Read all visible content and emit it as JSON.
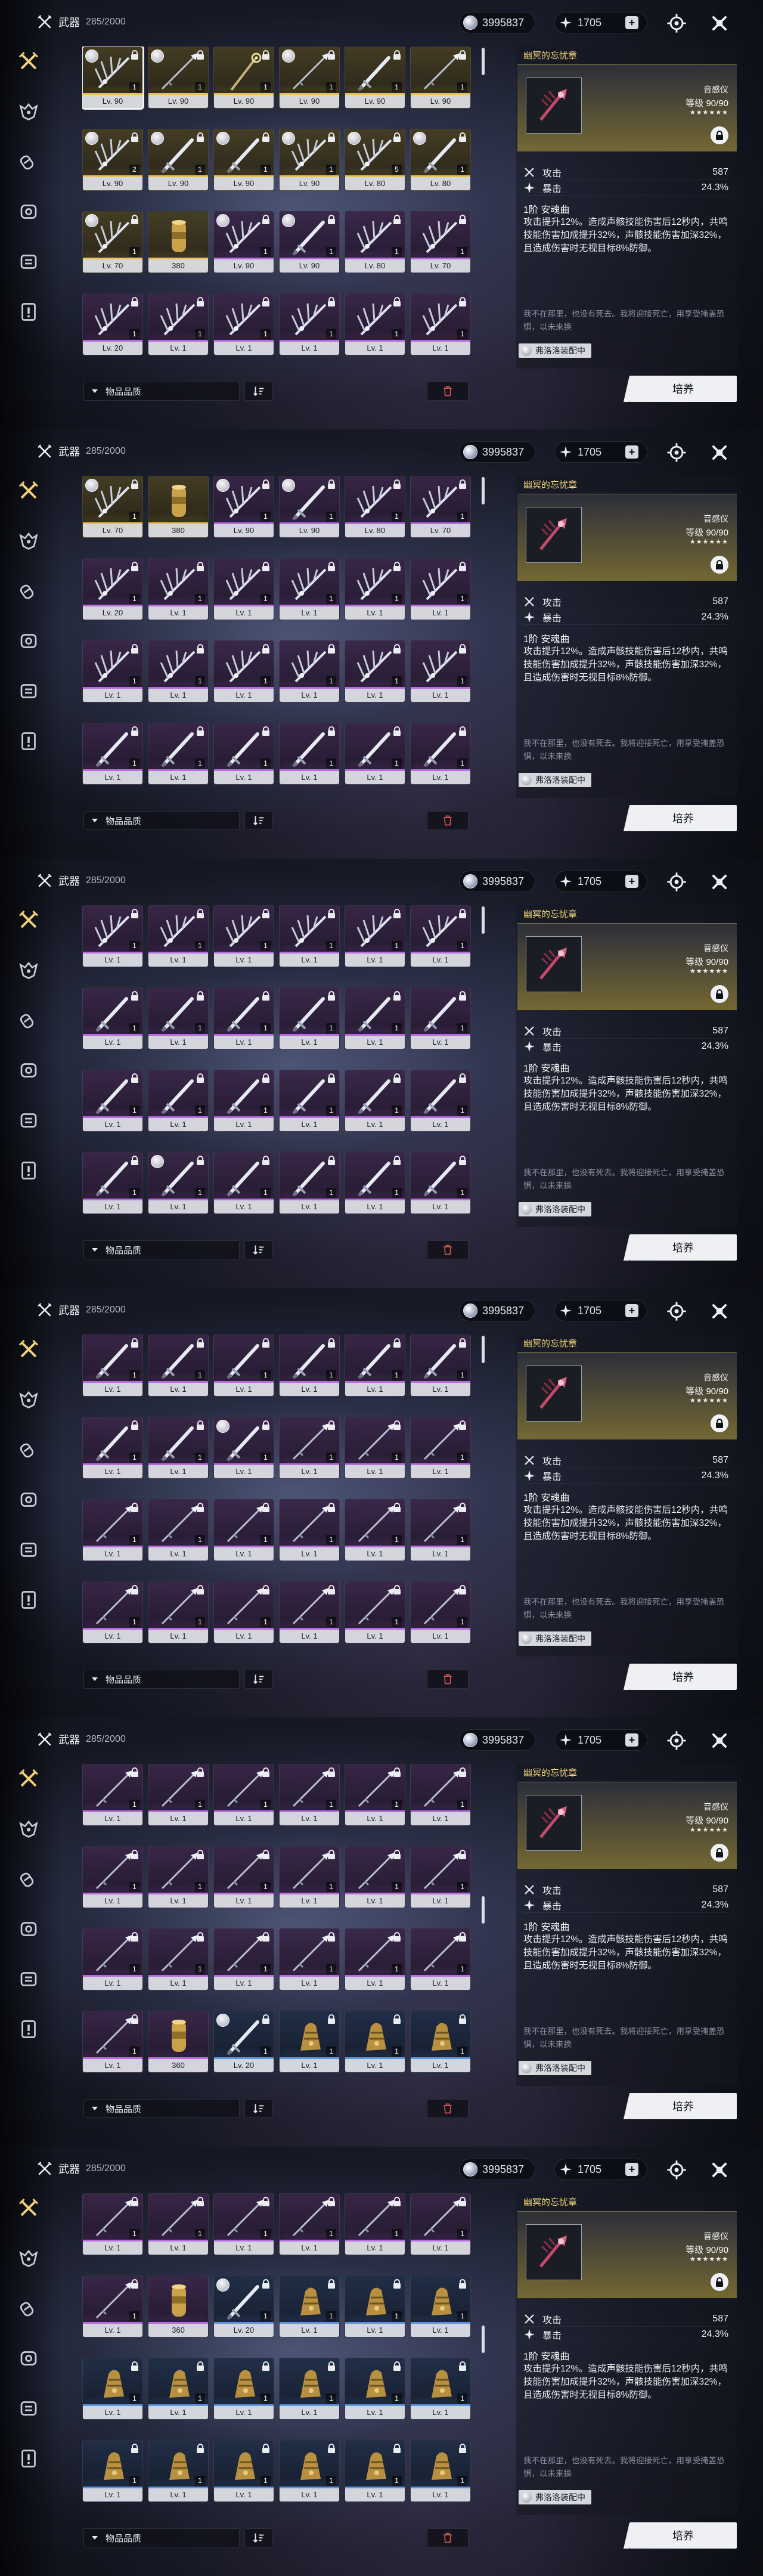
{
  "header": {
    "title": "武器",
    "count": "285/2000"
  },
  "currencies": [
    {
      "icon": "shell-credit-icon",
      "value": "3995837"
    },
    {
      "icon": "astrite-icon",
      "value": "1705",
      "plus": "+"
    }
  ],
  "sidebar": [
    "weapon-icon",
    "echo-icon",
    "supply-icon",
    "resources-icon",
    "key-items-icon",
    "special-icon"
  ],
  "detail": {
    "title": "幽冥的忘忧章",
    "type": "音感仪",
    "level_label": "等级",
    "level": "90/90",
    "stars": "★★★★★★",
    "stats": [
      {
        "icon": "atk-icon",
        "label": "攻击",
        "value": "587"
      },
      {
        "icon": "crit-icon",
        "label": "暴击",
        "value": "24.3%"
      }
    ],
    "skill_name": "1阶 安魂曲",
    "skill_desc": "攻击提升12%。造成声骸技能伤害后12秒内，共鸣技能伤害加成提升32%，声骸技能伤害加深32%，且造成伤害时无视目标8%防御。",
    "flavor": "我不在那里，也没有死去。我将迎接死亡，用享受掩盖恐惧，以未来换",
    "equipped_by": "弗洛洛装配中",
    "cultivate": "培养"
  },
  "bottom": {
    "sort_label": "物品品质"
  },
  "colors": {
    "gold": "#e9c15a",
    "purple": "#b66bde",
    "blue": "#5b95dd",
    "accent_title": "#f1d277"
  },
  "panels": [
    {
      "scroll": "top",
      "items": [
        {
          "lv": "Lv. 90",
          "r": 5,
          "rank": "1",
          "sel": true,
          "equip": true,
          "w": "fan"
        },
        {
          "lv": "Lv. 90",
          "r": 5,
          "rank": "1",
          "equip": true,
          "w": "spear"
        },
        {
          "lv": "Lv. 90",
          "r": 5,
          "rank": "1",
          "w": "staff"
        },
        {
          "lv": "Lv. 90",
          "r": 5,
          "rank": "1",
          "equip": true,
          "w": "spear"
        },
        {
          "lv": "Lv. 90",
          "r": 5,
          "rank": "1",
          "w": "sword"
        },
        {
          "lv": "Lv. 90",
          "r": 5,
          "rank": "1",
          "w": "spear"
        },
        {
          "lv": "Lv. 90",
          "r": 5,
          "rank": "2",
          "equip": true,
          "w": "fan"
        },
        {
          "lv": "Lv. 90",
          "r": 5,
          "rank": "1",
          "equip": true,
          "w": "sword"
        },
        {
          "lv": "Lv. 90",
          "r": 5,
          "rank": "1",
          "equip": true,
          "w": "sword"
        },
        {
          "lv": "Lv. 90",
          "r": 5,
          "rank": "1",
          "equip": true,
          "w": "fan"
        },
        {
          "lv": "Lv. 80",
          "r": 5,
          "rank": "5",
          "equip": true,
          "w": "fan"
        },
        {
          "lv": "Lv. 80",
          "r": 5,
          "rank": "1",
          "equip": true,
          "w": "sword"
        },
        {
          "lv": "Lv. 70",
          "r": 5,
          "rank": "1",
          "equip": true,
          "w": "fan"
        },
        {
          "lv": "380",
          "r": 5,
          "w": "cylinder"
        },
        {
          "lv": "Lv. 90",
          "r": 4,
          "rank": "1",
          "equip": true,
          "w": "fan"
        },
        {
          "lv": "Lv. 90",
          "r": 4,
          "rank": "1",
          "equip": true,
          "w": "sword"
        },
        {
          "lv": "Lv. 80",
          "r": 4,
          "rank": "1",
          "w": "fan"
        },
        {
          "lv": "Lv. 70",
          "r": 4,
          "rank": "1",
          "w": "fan"
        },
        {
          "lv": "Lv. 20",
          "r": 4,
          "rank": "1",
          "w": "fan"
        },
        {
          "lv": "Lv. 1",
          "r": 4,
          "rank": "1",
          "w": "fan"
        },
        {
          "lv": "Lv. 1",
          "r": 4,
          "rank": "1",
          "w": "fan"
        },
        {
          "lv": "Lv. 1",
          "r": 4,
          "rank": "1",
          "w": "fan"
        },
        {
          "lv": "Lv. 1",
          "r": 4,
          "rank": "1",
          "w": "fan"
        },
        {
          "lv": "Lv. 1",
          "r": 4,
          "rank": "1",
          "w": "fan"
        }
      ]
    },
    {
      "scroll": "top",
      "items": [
        {
          "lv": "Lv. 70",
          "r": 5,
          "rank": "1",
          "equip": true,
          "w": "fan"
        },
        {
          "lv": "380",
          "r": 5,
          "w": "cylinder"
        },
        {
          "lv": "Lv. 90",
          "r": 4,
          "rank": "1",
          "equip": true,
          "w": "fan"
        },
        {
          "lv": "Lv. 90",
          "r": 4,
          "rank": "1",
          "equip": true,
          "w": "sword"
        },
        {
          "lv": "Lv. 80",
          "r": 4,
          "rank": "1",
          "w": "fan"
        },
        {
          "lv": "Lv. 70",
          "r": 4,
          "rank": "1",
          "w": "fan"
        },
        {
          "lv": "Lv. 20",
          "r": 4,
          "rank": "1",
          "w": "fan"
        },
        {
          "lv": "Lv. 1",
          "r": 4,
          "rank": "1",
          "w": "fan"
        },
        {
          "lv": "Lv. 1",
          "r": 4,
          "rank": "1",
          "w": "fan"
        },
        {
          "lv": "Lv. 1",
          "r": 4,
          "rank": "1",
          "w": "fan"
        },
        {
          "lv": "Lv. 1",
          "r": 4,
          "rank": "1",
          "w": "fan"
        },
        {
          "lv": "Lv. 1",
          "r": 4,
          "rank": "1",
          "w": "fan"
        },
        {
          "lv": "Lv. 1",
          "r": 4,
          "rank": "1",
          "w": "fan"
        },
        {
          "lv": "Lv. 1",
          "r": 4,
          "rank": "1",
          "w": "fan"
        },
        {
          "lv": "Lv. 1",
          "r": 4,
          "rank": "1",
          "w": "fan"
        },
        {
          "lv": "Lv. 1",
          "r": 4,
          "rank": "1",
          "w": "fan"
        },
        {
          "lv": "Lv. 1",
          "r": 4,
          "rank": "1",
          "w": "fan"
        },
        {
          "lv": "Lv. 1",
          "r": 4,
          "rank": "1",
          "w": "fan"
        },
        {
          "lv": "Lv. 1",
          "r": 4,
          "rank": "1",
          "w": "sword"
        },
        {
          "lv": "Lv. 1",
          "r": 4,
          "rank": "1",
          "w": "sword"
        },
        {
          "lv": "Lv. 1",
          "r": 4,
          "rank": "1",
          "w": "sword"
        },
        {
          "lv": "Lv. 1",
          "r": 4,
          "rank": "1",
          "w": "sword"
        },
        {
          "lv": "Lv. 1",
          "r": 4,
          "rank": "1",
          "w": "sword"
        },
        {
          "lv": "Lv. 1",
          "r": 4,
          "rank": "1",
          "w": "sword"
        }
      ]
    },
    {
      "scroll": "top",
      "items": [
        {
          "lv": "Lv. 1",
          "r": 4,
          "rank": "1",
          "w": "fan"
        },
        {
          "lv": "Lv. 1",
          "r": 4,
          "rank": "1",
          "w": "fan"
        },
        {
          "lv": "Lv. 1",
          "r": 4,
          "rank": "1",
          "w": "fan"
        },
        {
          "lv": "Lv. 1",
          "r": 4,
          "rank": "1",
          "w": "fan"
        },
        {
          "lv": "Lv. 1",
          "r": 4,
          "rank": "1",
          "w": "fan"
        },
        {
          "lv": "Lv. 1",
          "r": 4,
          "rank": "1",
          "w": "fan"
        },
        {
          "lv": "Lv. 1",
          "r": 4,
          "rank": "1",
          "w": "sword"
        },
        {
          "lv": "Lv. 1",
          "r": 4,
          "rank": "1",
          "w": "sword"
        },
        {
          "lv": "Lv. 1",
          "r": 4,
          "rank": "1",
          "w": "sword"
        },
        {
          "lv": "Lv. 1",
          "r": 4,
          "rank": "1",
          "w": "sword"
        },
        {
          "lv": "Lv. 1",
          "r": 4,
          "rank": "1",
          "w": "sword"
        },
        {
          "lv": "Lv. 1",
          "r": 4,
          "rank": "1",
          "w": "sword"
        },
        {
          "lv": "Lv. 1",
          "r": 4,
          "rank": "1",
          "w": "sword"
        },
        {
          "lv": "Lv. 1",
          "r": 4,
          "rank": "1",
          "w": "sword"
        },
        {
          "lv": "Lv. 1",
          "r": 4,
          "rank": "1",
          "w": "sword"
        },
        {
          "lv": "Lv. 1",
          "r": 4,
          "rank": "1",
          "w": "sword"
        },
        {
          "lv": "Lv. 1",
          "r": 4,
          "rank": "1",
          "w": "sword"
        },
        {
          "lv": "Lv. 1",
          "r": 4,
          "rank": "1",
          "w": "sword"
        },
        {
          "lv": "Lv. 1",
          "r": 4,
          "rank": "1",
          "w": "sword"
        },
        {
          "lv": "Lv. 1",
          "r": 4,
          "rank": "1",
          "equip": true,
          "w": "sword"
        },
        {
          "lv": "Lv. 1",
          "r": 4,
          "rank": "1",
          "w": "sword"
        },
        {
          "lv": "Lv. 1",
          "r": 4,
          "rank": "1",
          "w": "sword"
        },
        {
          "lv": "Lv. 1",
          "r": 4,
          "rank": "1",
          "w": "sword"
        },
        {
          "lv": "Lv. 1",
          "r": 4,
          "rank": "1",
          "w": "sword"
        }
      ]
    },
    {
      "scroll": "top",
      "items": [
        {
          "lv": "Lv. 1",
          "r": 4,
          "rank": "1",
          "w": "sword"
        },
        {
          "lv": "Lv. 1",
          "r": 4,
          "rank": "1",
          "w": "sword"
        },
        {
          "lv": "Lv. 1",
          "r": 4,
          "rank": "1",
          "w": "sword"
        },
        {
          "lv": "Lv. 1",
          "r": 4,
          "rank": "1",
          "w": "sword"
        },
        {
          "lv": "Lv. 1",
          "r": 4,
          "rank": "1",
          "w": "sword"
        },
        {
          "lv": "Lv. 1",
          "r": 4,
          "rank": "1",
          "w": "sword"
        },
        {
          "lv": "Lv. 1",
          "r": 4,
          "rank": "1",
          "w": "sword"
        },
        {
          "lv": "Lv. 1",
          "r": 4,
          "rank": "1",
          "w": "sword"
        },
        {
          "lv": "Lv. 1",
          "r": 4,
          "rank": "1",
          "equip": true,
          "w": "sword"
        },
        {
          "lv": "Lv. 1",
          "r": 4,
          "rank": "1",
          "w": "spear"
        },
        {
          "lv": "Lv. 1",
          "r": 4,
          "rank": "1",
          "w": "spear"
        },
        {
          "lv": "Lv. 1",
          "r": 4,
          "rank": "1",
          "w": "spear"
        },
        {
          "lv": "Lv. 1",
          "r": 4,
          "rank": "1",
          "w": "spear"
        },
        {
          "lv": "Lv. 1",
          "r": 4,
          "rank": "1",
          "w": "spear"
        },
        {
          "lv": "Lv. 1",
          "r": 4,
          "rank": "1",
          "w": "spear"
        },
        {
          "lv": "Lv. 1",
          "r": 4,
          "rank": "1",
          "w": "spear"
        },
        {
          "lv": "Lv. 1",
          "r": 4,
          "rank": "1",
          "w": "spear"
        },
        {
          "lv": "Lv. 1",
          "r": 4,
          "rank": "1",
          "w": "spear"
        },
        {
          "lv": "Lv. 1",
          "r": 4,
          "rank": "1",
          "w": "spear"
        },
        {
          "lv": "Lv. 1",
          "r": 4,
          "rank": "1",
          "w": "spear"
        },
        {
          "lv": "Lv. 1",
          "r": 4,
          "rank": "1",
          "w": "spear"
        },
        {
          "lv": "Lv. 1",
          "r": 4,
          "rank": "1",
          "w": "spear"
        },
        {
          "lv": "Lv. 1",
          "r": 4,
          "rank": "1",
          "w": "spear"
        },
        {
          "lv": "Lv. 1",
          "r": 4,
          "rank": "1",
          "w": "spear"
        }
      ]
    },
    {
      "scroll": "low",
      "items": [
        {
          "lv": "Lv. 1",
          "r": 4,
          "rank": "1",
          "w": "spear"
        },
        {
          "lv": "Lv. 1",
          "r": 4,
          "rank": "1",
          "w": "spear"
        },
        {
          "lv": "Lv. 1",
          "r": 4,
          "rank": "1",
          "w": "spear"
        },
        {
          "lv": "Lv. 1",
          "r": 4,
          "rank": "1",
          "w": "spear"
        },
        {
          "lv": "Lv. 1",
          "r": 4,
          "rank": "1",
          "w": "spear"
        },
        {
          "lv": "Lv. 1",
          "r": 4,
          "rank": "1",
          "w": "spear"
        },
        {
          "lv": "Lv. 1",
          "r": 4,
          "rank": "1",
          "w": "spear"
        },
        {
          "lv": "Lv. 1",
          "r": 4,
          "rank": "1",
          "w": "spear"
        },
        {
          "lv": "Lv. 1",
          "r": 4,
          "rank": "1",
          "w": "spear"
        },
        {
          "lv": "Lv. 1",
          "r": 4,
          "rank": "1",
          "w": "spear"
        },
        {
          "lv": "Lv. 1",
          "r": 4,
          "rank": "1",
          "w": "spear"
        },
        {
          "lv": "Lv. 1",
          "r": 4,
          "rank": "1",
          "w": "spear"
        },
        {
          "lv": "Lv. 1",
          "r": 4,
          "rank": "1",
          "w": "spear"
        },
        {
          "lv": "Lv. 1",
          "r": 4,
          "rank": "1",
          "w": "spear"
        },
        {
          "lv": "Lv. 1",
          "r": 4,
          "rank": "1",
          "w": "spear"
        },
        {
          "lv": "Lv. 1",
          "r": 4,
          "rank": "1",
          "w": "spear"
        },
        {
          "lv": "Lv. 1",
          "r": 4,
          "rank": "1",
          "w": "spear"
        },
        {
          "lv": "Lv. 1",
          "r": 4,
          "rank": "1",
          "w": "spear"
        },
        {
          "lv": "Lv. 1",
          "r": 4,
          "rank": "1",
          "w": "spear"
        },
        {
          "lv": "360",
          "r": 4,
          "w": "cylinder"
        },
        {
          "lv": "Lv. 20",
          "r": 3,
          "rank": "1",
          "equip": true,
          "w": "sword"
        },
        {
          "lv": "Lv. 1",
          "r": 3,
          "rank": "1",
          "w": "gauntlet"
        },
        {
          "lv": "Lv. 1",
          "r": 3,
          "rank": "1",
          "w": "gauntlet"
        },
        {
          "lv": "Lv. 1",
          "r": 3,
          "rank": "1",
          "w": "gauntlet"
        }
      ]
    },
    {
      "scroll": "low",
      "items": [
        {
          "lv": "Lv. 1",
          "r": 4,
          "rank": "1",
          "w": "spear"
        },
        {
          "lv": "Lv. 1",
          "r": 4,
          "rank": "1",
          "w": "spear"
        },
        {
          "lv": "Lv. 1",
          "r": 4,
          "rank": "1",
          "w": "spear"
        },
        {
          "lv": "Lv. 1",
          "r": 4,
          "rank": "1",
          "w": "spear"
        },
        {
          "lv": "Lv. 1",
          "r": 4,
          "rank": "1",
          "w": "spear"
        },
        {
          "lv": "Lv. 1",
          "r": 4,
          "rank": "1",
          "w": "spear"
        },
        {
          "lv": "Lv. 1",
          "r": 4,
          "rank": "1",
          "w": "spear"
        },
        {
          "lv": "360",
          "r": 4,
          "w": "cylinder"
        },
        {
          "lv": "Lv. 20",
          "r": 3,
          "rank": "1",
          "equip": true,
          "w": "sword"
        },
        {
          "lv": "Lv. 1",
          "r": 3,
          "rank": "1",
          "w": "gauntlet"
        },
        {
          "lv": "Lv. 1",
          "r": 3,
          "rank": "1",
          "w": "gauntlet"
        },
        {
          "lv": "Lv. 1",
          "r": 3,
          "rank": "1",
          "w": "gauntlet"
        },
        {
          "lv": "Lv. 1",
          "r": 3,
          "rank": "1",
          "w": "gauntlet"
        },
        {
          "lv": "Lv. 1",
          "r": 3,
          "rank": "1",
          "w": "gauntlet"
        },
        {
          "lv": "Lv. 1",
          "r": 3,
          "rank": "1",
          "w": "gauntlet"
        },
        {
          "lv": "Lv. 1",
          "r": 3,
          "rank": "1",
          "w": "gauntlet"
        },
        {
          "lv": "Lv. 1",
          "r": 3,
          "rank": "1",
          "w": "gauntlet"
        },
        {
          "lv": "Lv. 1",
          "r": 3,
          "rank": "1",
          "w": "gauntlet"
        },
        {
          "lv": "Lv. 1",
          "r": 3,
          "rank": "1",
          "w": "gauntlet"
        },
        {
          "lv": "Lv. 1",
          "r": 3,
          "rank": "1",
          "w": "gauntlet"
        },
        {
          "lv": "Lv. 1",
          "r": 3,
          "rank": "1",
          "w": "gauntlet"
        },
        {
          "lv": "Lv. 1",
          "r": 3,
          "rank": "1",
          "w": "gauntlet"
        },
        {
          "lv": "Lv. 1",
          "r": 3,
          "rank": "1",
          "w": "gauntlet"
        },
        {
          "lv": "Lv. 1",
          "r": 3,
          "rank": "1",
          "w": "gauntlet"
        }
      ]
    }
  ]
}
